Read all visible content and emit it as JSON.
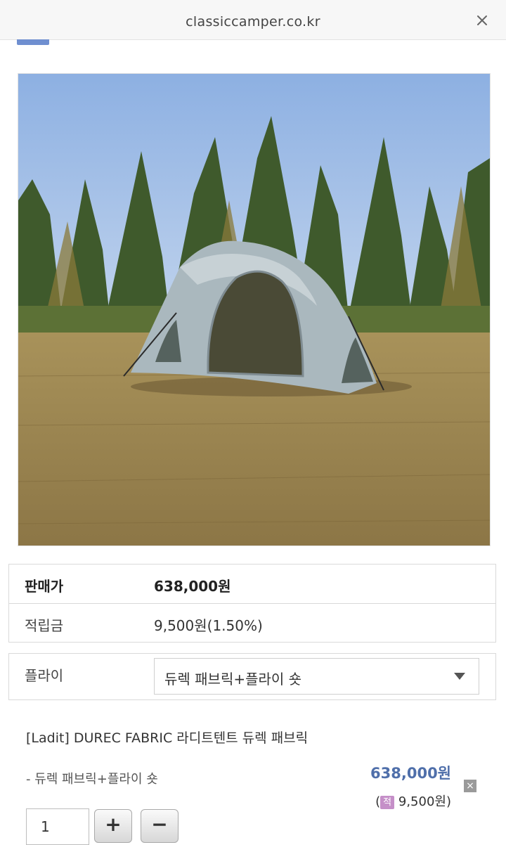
{
  "browser": {
    "url": "classiccamper.co.kr"
  },
  "product": {
    "price_label": "판매가",
    "price_value": "638,000원",
    "points_label": "적립금",
    "points_value": "9,500원(1.50%)"
  },
  "option": {
    "label": "플라이",
    "selected_value": "듀렉 패브릭+플라이 숏"
  },
  "selected_item": {
    "name": "[Ladit] DUREC FABRIC 라디트텐트 듀렉 패브릭",
    "option_text": "- 듀렉 패브릭+플라이 숏",
    "price": "638,000원",
    "points_icon": "적",
    "points_value": "9,500원",
    "points_open": "(",
    "points_close": ")",
    "remove_symbol": "×",
    "quantity": "1",
    "plus_symbol": "+",
    "minus_symbol": "−"
  }
}
